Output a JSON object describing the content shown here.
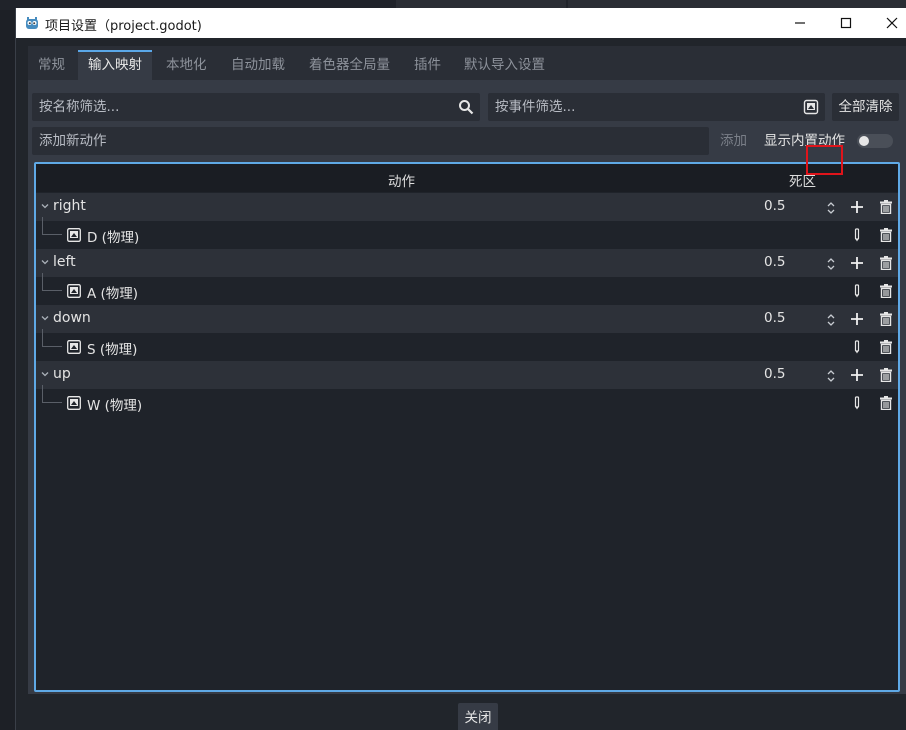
{
  "window": {
    "title": "项目设置（project.godot)",
    "minimize_icon": "minimize-icon",
    "maximize_icon": "maximize-icon",
    "close_icon": "close-icon"
  },
  "tabs": [
    {
      "label": "常规",
      "active": false
    },
    {
      "label": "输入映射",
      "active": true
    },
    {
      "label": "本地化",
      "active": false
    },
    {
      "label": "自动加载",
      "active": false
    },
    {
      "label": "着色器全局量",
      "active": false
    },
    {
      "label": "插件",
      "active": false
    },
    {
      "label": "默认导入设置",
      "active": false
    }
  ],
  "filters": {
    "name_placeholder": "按名称筛选...",
    "event_placeholder": "按事件筛选...",
    "clear_all_label": "全部清除"
  },
  "add_action": {
    "placeholder": "添加新动作",
    "add_label": "添加",
    "show_builtin_label": "显示内置动作",
    "show_builtin_enabled": false
  },
  "table": {
    "col_action": "动作",
    "col_deadzone": "死区",
    "actions": [
      {
        "name": "right",
        "deadzone": "0.5",
        "event": "D (物理)"
      },
      {
        "name": "left",
        "deadzone": "0.5",
        "event": "A (物理)"
      },
      {
        "name": "down",
        "deadzone": "0.5",
        "event": "S (物理)"
      },
      {
        "name": "up",
        "deadzone": "0.5",
        "event": "W (物理)"
      }
    ]
  },
  "footer": {
    "close_label": "关闭"
  },
  "colors": {
    "accent": "#5fa9e6",
    "highlight": "#e0141b"
  }
}
